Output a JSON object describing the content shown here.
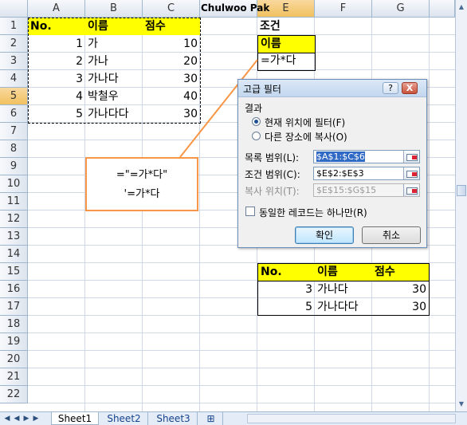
{
  "sheet": {
    "author_label": "Chulwoo Pak",
    "columns": [
      "A",
      "B",
      "C",
      "D",
      "E",
      "F",
      "G"
    ],
    "selected_column": "E",
    "rows": [
      "1",
      "2",
      "3",
      "4",
      "5",
      "6",
      "7",
      "8",
      "9",
      "10",
      "11",
      "12",
      "13",
      "14",
      "15",
      "16",
      "17",
      "18",
      "19",
      "20",
      "21",
      "22"
    ],
    "selected_row": "5",
    "source_table": {
      "headers": [
        "No.",
        "이름",
        "점수"
      ],
      "rows": [
        [
          "1",
          "가",
          "10"
        ],
        [
          "2",
          "가나",
          "20"
        ],
        [
          "3",
          "가나다",
          "30"
        ],
        [
          "4",
          "박철우",
          "40"
        ],
        [
          "5",
          "가나다다",
          "30"
        ]
      ]
    },
    "criteria": {
      "title": "조건",
      "header": "이름",
      "value": "=가*다"
    },
    "result_table": {
      "headers": [
        "No.",
        "이름",
        "점수"
      ],
      "rows": [
        [
          "3",
          "가나다",
          "30"
        ],
        [
          "5",
          "가나다다",
          "30"
        ]
      ]
    },
    "callout": {
      "line1": "=\"=가*다\"",
      "line2": "'=가*다"
    }
  },
  "dialog": {
    "title": "고급 필터",
    "help_glyph": "?",
    "close_glyph": "X",
    "result_group_label": "결과",
    "option_filter_in_place": "현재 위치에 필터(F)",
    "option_copy_to": "다른 장소에 복사(O)",
    "list_range_label": "목록 범위(L):",
    "list_range_value": "$A$1:$C$6",
    "criteria_range_label": "조건 범위(C):",
    "criteria_range_value": "$E$2:$E$3",
    "copy_to_label": "복사 위치(T):",
    "copy_to_value": "$E$15:$G$15",
    "unique_label": "동일한 레코드는 하나만(R)",
    "ok_label": "확인",
    "cancel_label": "취소"
  },
  "tabs": {
    "sheets": [
      "Sheet1",
      "Sheet2",
      "Sheet3"
    ],
    "active": "Sheet1"
  },
  "colors": {
    "header_yellow": "#ffff00",
    "callout_border": "#f79646",
    "selected_header": "#f1c15f"
  }
}
